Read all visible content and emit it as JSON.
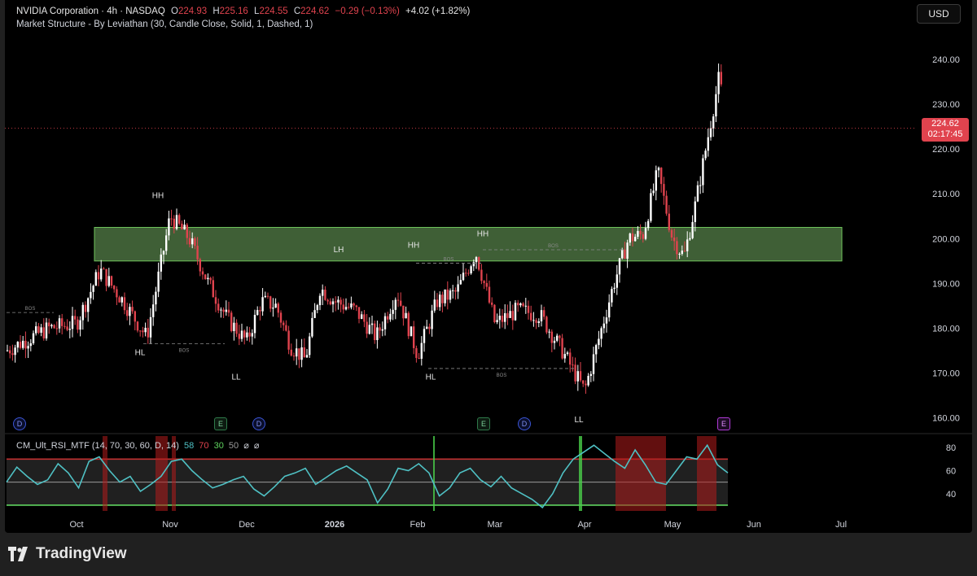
{
  "header": {
    "symbol": "NVIDIA Corporation · 4h · NASDAQ",
    "o_label": "O",
    "o_val": "224.93",
    "h_label": "H",
    "h_val": "225.16",
    "l_label": "L",
    "l_val": "224.55",
    "c_label": "C",
    "c_val": "224.62",
    "change": "−0.29 (−0.13%)",
    "change2": "+4.02 (+1.82%)",
    "indicator": "Market Structure - By Leviathan (30, Candle Close, Solid, 1, Dashed, 1)"
  },
  "currency_button": "USD",
  "price_tag": {
    "price": "224.62",
    "countdown": "02:17:45"
  },
  "price_axis": [
    "240.00",
    "230.00",
    "220.00",
    "210.00",
    "200.00",
    "190.00",
    "180.00",
    "170.00",
    "160.00"
  ],
  "time_axis": [
    "Oct",
    "Nov",
    "Dec",
    "2026",
    "Feb",
    "Mar",
    "Apr",
    "May",
    "Jun",
    "Jul"
  ],
  "rsi_axis": [
    "80",
    "60",
    "40"
  ],
  "rsi_header": {
    "name": "CM_Ult_RSI_MTF (14, 70, 30, 60, D, 14)",
    "v1": "58",
    "v2": "70",
    "v3": "30",
    "v4": "50",
    "v5": "⌀",
    "v6": "⌀"
  },
  "structure_labels": [
    "HH",
    "LH",
    "HH",
    "HH",
    "HL",
    "LL",
    "HL",
    "LL"
  ],
  "bos_label": "BOS",
  "event_markers": [
    "D",
    "E",
    "D",
    "E",
    "D",
    "E"
  ],
  "brand": "TradingView",
  "colors": {
    "up": "#ffffff",
    "down": "#e0434e",
    "zone": "#3f5f36",
    "rsi": "#4fc1c4"
  },
  "chart_data": {
    "type": "candlestick",
    "title": "NVIDIA Corporation · 4h · NASDAQ",
    "ylim": [
      157,
      246
    ],
    "x_range": [
      "Sep 2025",
      "Jul 2026"
    ],
    "close_path": [
      [
        "Sep",
        175
      ],
      [
        "Sep",
        180
      ],
      [
        "Oct",
        181
      ],
      [
        "Oct",
        193
      ],
      [
        "Oct",
        186
      ],
      [
        "Oct",
        178
      ],
      [
        "Nov",
        205
      ],
      [
        "Nov",
        200
      ],
      [
        "Nov",
        190
      ],
      [
        "Nov",
        182
      ],
      [
        "Dec",
        177
      ],
      [
        "Dec",
        186
      ],
      [
        "Dec",
        185
      ],
      [
        "Dec",
        176
      ],
      [
        "Dec",
        173
      ],
      [
        "Dec",
        189
      ],
      [
        "Jan",
        186
      ],
      [
        "Jan",
        184
      ],
      [
        "Jan",
        178
      ],
      [
        "Jan",
        188
      ],
      [
        "Feb",
        174
      ],
      [
        "Feb",
        186
      ],
      [
        "Feb",
        188
      ],
      [
        "Feb",
        197
      ],
      [
        "Mar",
        181
      ],
      [
        "Mar",
        184
      ],
      [
        "Mar",
        183
      ],
      [
        "Mar",
        175
      ],
      [
        "Apr",
        166
      ],
      [
        "Apr",
        178
      ],
      [
        "Apr",
        190
      ],
      [
        "Apr",
        200
      ],
      [
        "Apr",
        201
      ],
      [
        "Apr",
        215
      ],
      [
        "May",
        200
      ],
      [
        "May",
        196
      ],
      [
        "May",
        208
      ],
      [
        "May",
        222
      ],
      [
        "May",
        236
      ],
      [
        "May",
        221
      ],
      [
        "May",
        224.62
      ]
    ],
    "zone": {
      "low": 195,
      "high": 202.5
    },
    "levels": {
      "last_price": 224.62
    },
    "rsi": {
      "ylim": [
        25,
        90
      ],
      "bands": [
        70,
        50,
        30
      ],
      "values": [
        50,
        63,
        55,
        48,
        52,
        66,
        58,
        45,
        68,
        72,
        60,
        50,
        55,
        42,
        48,
        55,
        68,
        70,
        60,
        52,
        45,
        48,
        52,
        55,
        44,
        38,
        46,
        55,
        58,
        62,
        48,
        54,
        60,
        64,
        58,
        52,
        32,
        44,
        62,
        60,
        66,
        58,
        38,
        45,
        58,
        62,
        52,
        46,
        55,
        45,
        40,
        35,
        28,
        40,
        58,
        70,
        76,
        82,
        75,
        68,
        62,
        78,
        65,
        50,
        48,
        60,
        72,
        70,
        82,
        65,
        58
      ]
    }
  }
}
